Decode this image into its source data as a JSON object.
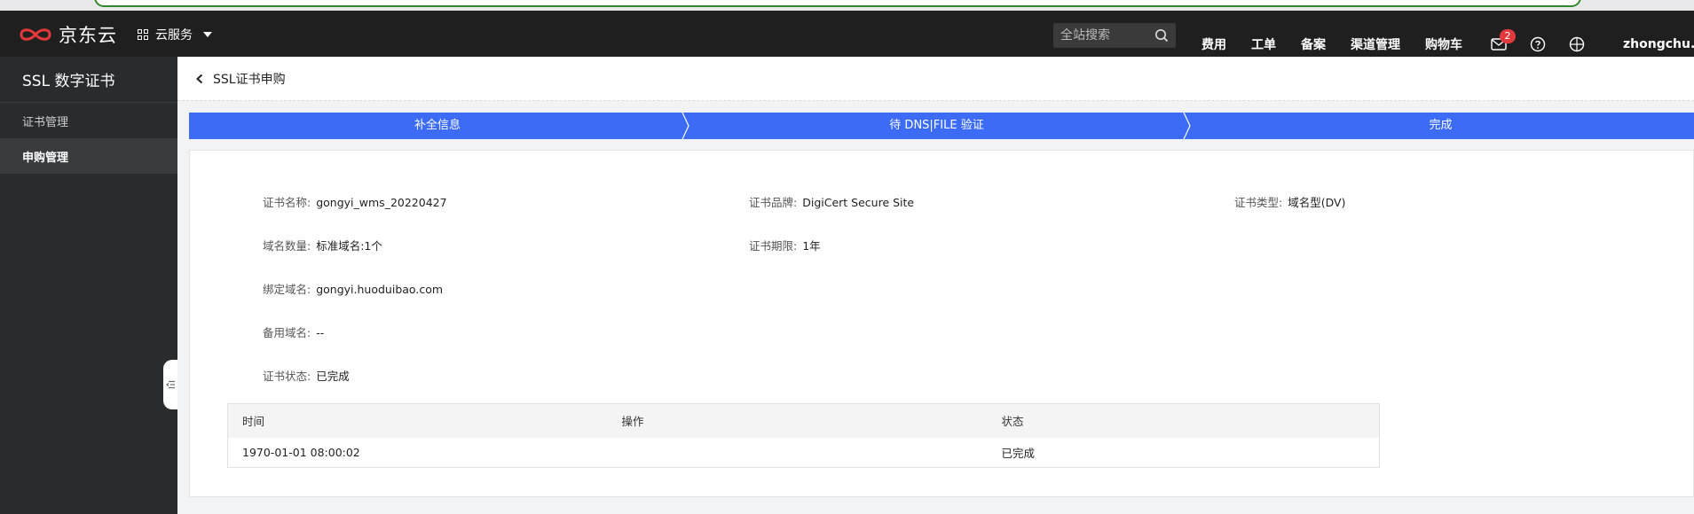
{
  "topbar": {
    "logo_text": "京东云",
    "service_menu_label": "云服务",
    "search_placeholder": "全站搜索",
    "nav": [
      "费用",
      "工单",
      "备案",
      "渠道管理",
      "购物车"
    ],
    "message_badge": "2",
    "username": "zhongchu..."
  },
  "sidebar": {
    "title": "SSL 数字证书",
    "items": [
      {
        "label": "证书管理",
        "active": false
      },
      {
        "label": "申购管理",
        "active": true
      }
    ]
  },
  "header": {
    "title": "SSL证书申购"
  },
  "steps": [
    "补全信息",
    "待 DNS|FILE 验证",
    "完成"
  ],
  "details": {
    "name_label": "证书名称:",
    "name_value": "gongyi_wms_20220427",
    "brand_label": "证书品牌:",
    "brand_value": "DigiCert Secure Site",
    "type_label": "证书类型:",
    "type_value": "域名型(DV)",
    "count_label": "域名数量:",
    "count_value": "标准域名:1个",
    "period_label": "证书期限:",
    "period_value": "1年",
    "domain_label": "绑定域名:",
    "domain_value": "gongyi.huoduibao.com",
    "alt_label": "备用域名:",
    "alt_value": "--",
    "status_label": "证书状态:",
    "status_value": "已完成"
  },
  "log_table": {
    "headers": [
      "时间",
      "操作",
      "状态"
    ],
    "rows": [
      [
        "1970-01-01 08:00:02",
        "",
        "已完成"
      ]
    ]
  },
  "colors": {
    "topbar_bg": "#1f1f1f",
    "sidebar_bg": "#2a2b2d",
    "step_blue": "#3c6cf6",
    "brand_red": "#e4393c"
  }
}
